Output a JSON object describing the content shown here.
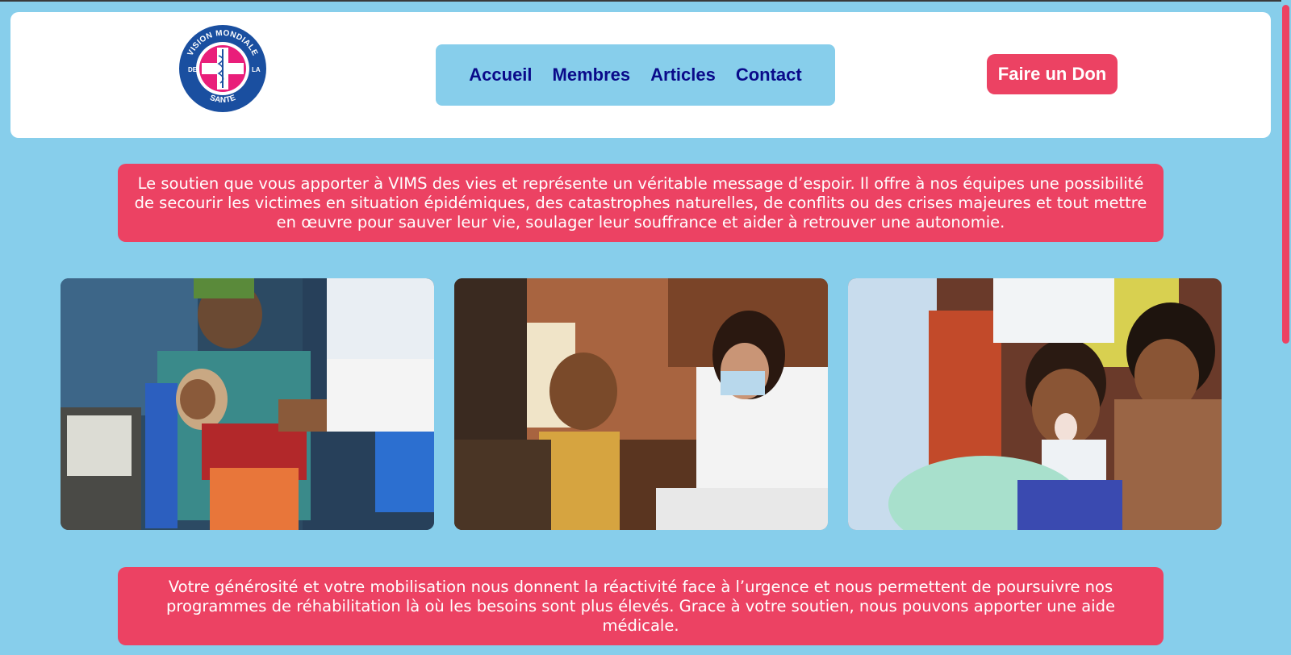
{
  "logo": {
    "text_top": "VISION MONDIALE",
    "text_left": "DE",
    "text_right": "LA",
    "text_bottom": "SANTE"
  },
  "nav": {
    "items": [
      "Accueil",
      "Membres",
      "Articles",
      "Contact"
    ]
  },
  "donate_button": "Faire un Don",
  "banner_top": "Le soutien que vous apporter à VIMS des vies et représente un véritable message d’espoir. Il offre à nos équipes une possibilité de secourir les victimes en situation épidémiques, des catastrophes naturelles, de conflits ou des crises majeures et tout mettre en œuvre pour sauver leur vie, soulager leur souffrance et aider à retrouver une autonomie.",
  "banner_bottom": "Votre générosité et votre mobilisation nous donnent la réactivité face à l’urgence et nous permettent de poursuivre nos programmes de réhabilitation là où les besoins sont plus élevés. Grace à votre soutien, nous pouvons apporter une aide médicale.",
  "colors": {
    "background": "#87ceeb",
    "accent": "#ec4263",
    "nav_text": "#0a0a8a",
    "logo_blue": "#1a4fa0",
    "logo_pink": "#e91e7a"
  }
}
